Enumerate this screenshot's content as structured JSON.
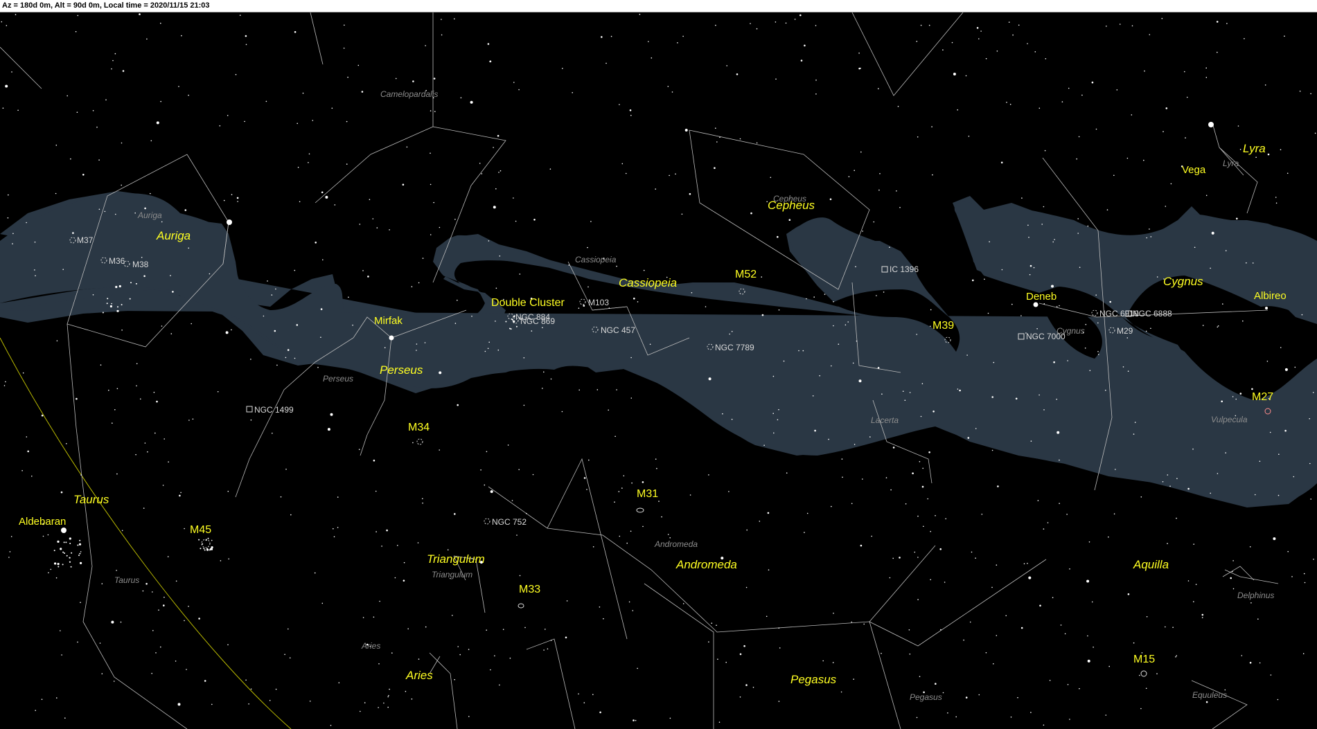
{
  "status": {
    "text": "Az = 180d 0m, Alt = 90d 0m, Local time = 2020/11/15 21:03"
  },
  "colors": {
    "sky": "#000000",
    "milky_way": "#2a3744",
    "constellation_lines": "#bdbdbd",
    "ecliptic": "#b8b800",
    "label_yellow": "#ffff22",
    "label_gray": "#8d8d8d",
    "dso_label": "#d9d9d9"
  },
  "constellation_labels_bright": [
    "Auriga",
    "Perseus",
    "Taurus",
    "Triangulum",
    "Aries",
    "Cassiopeia",
    "Cepheus",
    "Andromeda",
    "Pegasus",
    "Cygnus",
    "Lyra",
    "Aquilla"
  ],
  "constellation_labels_dim": [
    "Camelopardalis",
    "Auriga",
    "Perseus",
    "Taurus",
    "Triangulum",
    "Aries",
    "Cassiopeia",
    "Cepheus",
    "Andromeda",
    "Pegasus",
    "Lacerta",
    "Lyra",
    "Vulpecula",
    "Delphinus",
    "Equuleus",
    "Cygnus"
  ],
  "star_labels": [
    "Aldebaran",
    "Mirfak",
    "Deneb",
    "Vega",
    "Albireo"
  ],
  "object_labels": [
    "M45",
    "M34",
    "M31",
    "M33",
    "Double Cluster",
    "M52",
    "M39",
    "M27",
    "M15"
  ],
  "dso_labels": [
    "M37",
    "M36",
    "M38",
    "NGC 1499",
    "NGC 752",
    "NGC 884",
    "NGC 869",
    "M103",
    "NGC 457",
    "NGC 7789",
    "IC 1396",
    "NGC 7000",
    "NGC 6910",
    "NGC 6888",
    "M29"
  ]
}
